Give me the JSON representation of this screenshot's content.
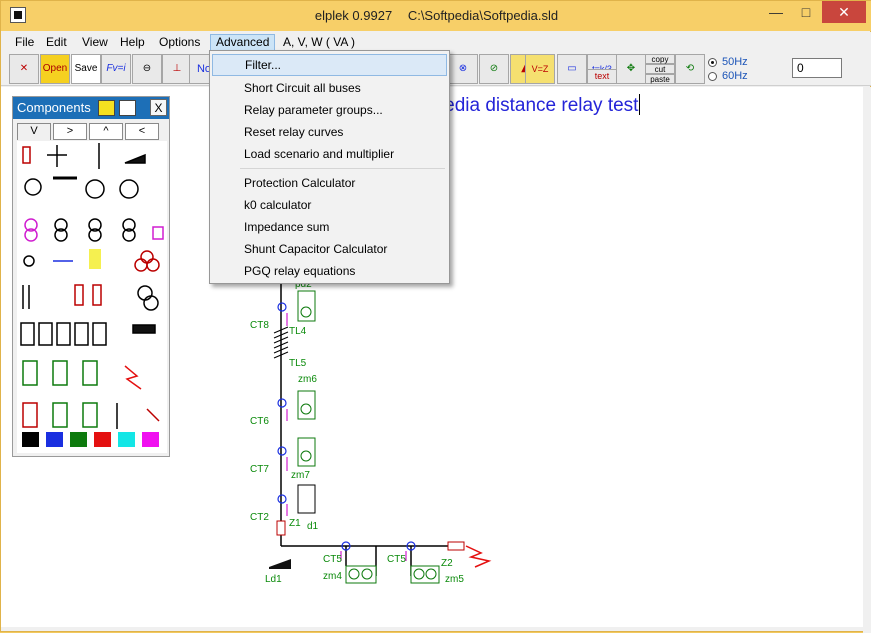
{
  "window": {
    "app_name": "elplek 0.9927",
    "file_path": "C:\\Softpedia\\Softpedia.sld",
    "min_glyph": "—",
    "max_glyph": "□",
    "close_glyph": "✕"
  },
  "menubar": {
    "items": [
      "File",
      "Edit",
      "View",
      "Help",
      "Options",
      "Advanced"
    ],
    "active": "Advanced",
    "extra_label": "A, V, W ( VA )"
  },
  "toolbar": {
    "freq_50": "50Hz",
    "freq_60": "60Hz",
    "selected_freq": "50Hz",
    "number_value": "0",
    "open_label": "Open",
    "save_label": "Save",
    "formula_label": "Fv=i",
    "tk_label": "t=k/3",
    "text_label": "text",
    "copy_label": "copy",
    "cut_label": "cut",
    "paste_label": "paste",
    "no_label": "No",
    "v_label": "V=Z"
  },
  "advanced_menu": {
    "items": [
      "Filter...",
      "Short Circuit all buses",
      "Relay parameter groups...",
      "Reset relay curves",
      "Load scenario and multiplier",
      "Protection Calculator",
      "k0 calculator",
      "Impedance sum",
      "Shunt Capacitor Calculator",
      "PGQ relay equations"
    ],
    "highlighted": "Filter..."
  },
  "components_panel": {
    "title": "Components",
    "close_label": "X",
    "tabs": [
      "V",
      ">",
      "^",
      "<"
    ],
    "swatch_colors": [
      "#000000",
      "#1a2fe0",
      "#0d7a0d",
      "#e41010",
      "#13e6e6",
      "#f010f0"
    ]
  },
  "drawing": {
    "title_text": "ftpedia distance relay test",
    "labels": [
      "pd2",
      "CT8",
      "TL4",
      "TL5",
      "zm6",
      "CT6",
      "CT7",
      "zm7",
      "CT2",
      "Z1",
      "d1",
      "Ld1",
      "CT5",
      "zm4",
      "CT5",
      "Z2",
      "zm5"
    ]
  }
}
